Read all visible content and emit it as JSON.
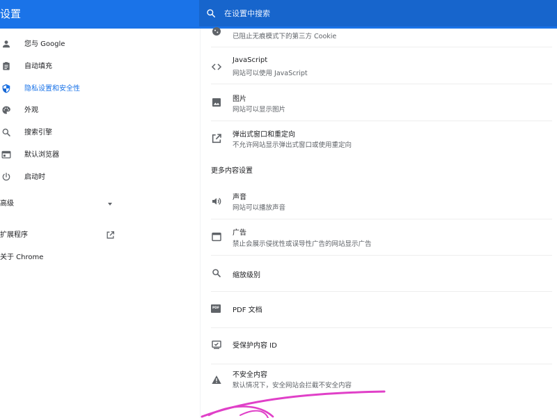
{
  "header": {
    "title": "设置",
    "search_placeholder": "在设置中搜索"
  },
  "sidebar": {
    "items": [
      {
        "label": "您与 Google",
        "icon": "person-icon"
      },
      {
        "label": "自动填充",
        "icon": "clipboard-icon"
      },
      {
        "label": "隐私设置和安全性",
        "icon": "shield-icon",
        "active": true
      },
      {
        "label": "外观",
        "icon": "palette-icon"
      },
      {
        "label": "搜索引擎",
        "icon": "search-icon"
      },
      {
        "label": "默认浏览器",
        "icon": "browser-icon"
      },
      {
        "label": "启动时",
        "icon": "power-icon"
      }
    ],
    "advanced_label": "高级",
    "extensions_label": "扩展程序",
    "about_label": "关于 Chrome"
  },
  "main": {
    "top_partial_sub": "已阻止无痕模式下的第三方 Cookie",
    "rows": [
      {
        "title": "JavaScript",
        "sub": "网站可以使用 JavaScript",
        "icon": "code-icon"
      },
      {
        "title": "图片",
        "sub": "网站可以显示图片",
        "icon": "image-icon"
      },
      {
        "title": "弹出式窗口和重定向",
        "sub": "不允许网站显示弹出式窗口或使用重定向",
        "icon": "open-in-new-icon"
      }
    ],
    "more_section_title": "更多内容设置",
    "more_rows": [
      {
        "title": "声音",
        "sub": "网站可以播放声音",
        "icon": "volume-icon"
      },
      {
        "title": "广告",
        "sub": "禁止会展示侵扰性或误导性广告的网站显示广告",
        "icon": "ad-window-icon"
      },
      {
        "title": "缩放级别",
        "sub": "",
        "icon": "zoom-icon"
      },
      {
        "title": "PDF 文档",
        "sub": "",
        "icon": "pdf-icon"
      },
      {
        "title": "受保护内容 ID",
        "sub": "",
        "icon": "protected-content-icon"
      },
      {
        "title": "不安全内容",
        "sub": "默认情况下，安全网站会拦截不安全内容",
        "icon": "warning-icon"
      }
    ],
    "pdf_icon_text": "PDF"
  },
  "colors": {
    "header_bg": "#1a73e8",
    "search_bg": "#1765cc",
    "active": "#1a73e8",
    "text": "#202124",
    "subtext": "#5f6368",
    "scribble": "#e040c8"
  }
}
